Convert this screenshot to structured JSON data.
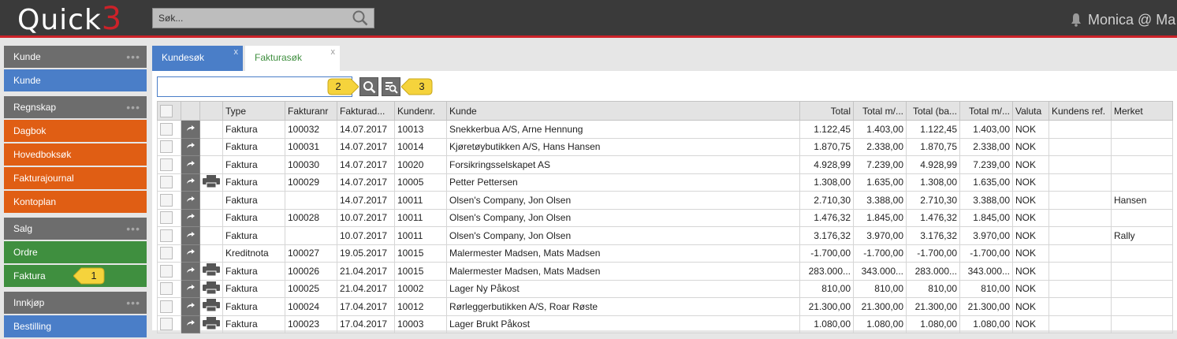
{
  "app": {
    "logo_text": "Quick",
    "logo_num": "3"
  },
  "header": {
    "search_placeholder": "Søk...",
    "user": "Monica @ Ma"
  },
  "sidebar": {
    "kunde_head": "Kunde",
    "kunde_items": [
      "Kunde"
    ],
    "regnskap_head": "Regnskap",
    "regnskap_items": [
      "Dagbok",
      "Hovedboksøk",
      "Fakturajournal",
      "Kontoplan"
    ],
    "salg_head": "Salg",
    "salg_items": [
      "Ordre",
      "Faktura"
    ],
    "innkjop_head": "Innkjøp",
    "innkjop_items": [
      "Bestilling"
    ],
    "dots": "•••"
  },
  "callouts": {
    "c1": "1",
    "c2": "2",
    "c3": "3"
  },
  "tabs": [
    {
      "label": "Kundesøk",
      "close": "x"
    },
    {
      "label": "Fakturasøk",
      "close": "x"
    }
  ],
  "filter": {
    "value": ""
  },
  "table": {
    "columns": [
      "",
      "",
      "",
      "Type",
      "Fakturanr",
      "Fakturad...",
      "Kundenr.",
      "Kunde",
      "Total",
      "Total m/...",
      "Total (ba...",
      "Total m/...",
      "Valuta",
      "Kundens ref.",
      "Merket"
    ],
    "rows": [
      {
        "print": false,
        "type": "Faktura",
        "nr": "100032",
        "date": "14.07.2017",
        "kundenr": "10013",
        "kunde": "Snekkerbua A/S, Arne Hennung",
        "t1": "1.122,45",
        "t2": "1.403,00",
        "t3": "1.122,45",
        "t4": "1.403,00",
        "valuta": "NOK",
        "ref": "",
        "merket": ""
      },
      {
        "print": false,
        "type": "Faktura",
        "nr": "100031",
        "date": "14.07.2017",
        "kundenr": "10014",
        "kunde": "Kjøretøybutikken A/S, Hans Hansen",
        "t1": "1.870,75",
        "t2": "2.338,00",
        "t3": "1.870,75",
        "t4": "2.338,00",
        "valuta": "NOK",
        "ref": "",
        "merket": ""
      },
      {
        "print": false,
        "type": "Faktura",
        "nr": "100030",
        "date": "14.07.2017",
        "kundenr": "10020",
        "kunde": "Forsikringsselskapet AS",
        "t1": "4.928,99",
        "t2": "7.239,00",
        "t3": "4.928,99",
        "t4": "7.239,00",
        "valuta": "NOK",
        "ref": "",
        "merket": ""
      },
      {
        "print": true,
        "type": "Faktura",
        "nr": "100029",
        "date": "14.07.2017",
        "kundenr": "10005",
        "kunde": "Petter Pettersen",
        "t1": "1.308,00",
        "t2": "1.635,00",
        "t3": "1.308,00",
        "t4": "1.635,00",
        "valuta": "NOK",
        "ref": "",
        "merket": ""
      },
      {
        "print": false,
        "type": "Faktura",
        "nr": "",
        "date": "14.07.2017",
        "kundenr": "10011",
        "kunde": "Olsen's Company, Jon Olsen",
        "t1": "2.710,30",
        "t2": "3.388,00",
        "t3": "2.710,30",
        "t4": "3.388,00",
        "valuta": "NOK",
        "ref": "",
        "merket": "Hansen"
      },
      {
        "print": false,
        "type": "Faktura",
        "nr": "100028",
        "date": "10.07.2017",
        "kundenr": "10011",
        "kunde": "Olsen's Company, Jon Olsen",
        "t1": "1.476,32",
        "t2": "1.845,00",
        "t3": "1.476,32",
        "t4": "1.845,00",
        "valuta": "NOK",
        "ref": "",
        "merket": ""
      },
      {
        "print": false,
        "type": "Faktura",
        "nr": "",
        "date": "10.07.2017",
        "kundenr": "10011",
        "kunde": "Olsen's Company, Jon Olsen",
        "t1": "3.176,32",
        "t2": "3.970,00",
        "t3": "3.176,32",
        "t4": "3.970,00",
        "valuta": "NOK",
        "ref": "",
        "merket": "Rally"
      },
      {
        "print": false,
        "type": "Kreditnota",
        "nr": "100027",
        "date": "19.05.2017",
        "kundenr": "10015",
        "kunde": "Malermester Madsen, Mats Madsen",
        "t1": "-1.700,00",
        "t2": "-1.700,00",
        "t3": "-1.700,00",
        "t4": "-1.700,00",
        "valuta": "NOK",
        "ref": "",
        "merket": ""
      },
      {
        "print": true,
        "type": "Faktura",
        "nr": "100026",
        "date": "21.04.2017",
        "kundenr": "10015",
        "kunde": "Malermester Madsen, Mats Madsen",
        "t1": "283.000...",
        "t2": "343.000...",
        "t3": "283.000...",
        "t4": "343.000...",
        "valuta": "NOK",
        "ref": "",
        "merket": ""
      },
      {
        "print": true,
        "type": "Faktura",
        "nr": "100025",
        "date": "21.04.2017",
        "kundenr": "10002",
        "kunde": "Lager Ny Påkost",
        "t1": "810,00",
        "t2": "810,00",
        "t3": "810,00",
        "t4": "810,00",
        "valuta": "NOK",
        "ref": "",
        "merket": ""
      },
      {
        "print": true,
        "type": "Faktura",
        "nr": "100024",
        "date": "17.04.2017",
        "kundenr": "10012",
        "kunde": "Rørleggerbutikken A/S, Roar Røste",
        "t1": "21.300,00",
        "t2": "21.300,00",
        "t3": "21.300,00",
        "t4": "21.300,00",
        "valuta": "NOK",
        "ref": "",
        "merket": ""
      },
      {
        "print": true,
        "type": "Faktura",
        "nr": "100023",
        "date": "17.04.2017",
        "kundenr": "10003",
        "kunde": "Lager Brukt Påkost",
        "t1": "1.080,00",
        "t2": "1.080,00",
        "t3": "1.080,00",
        "t4": "1.080,00",
        "valuta": "NOK",
        "ref": "",
        "merket": ""
      }
    ]
  },
  "colors": {
    "accent_red": "#cc2229",
    "blue": "#4a7ec8",
    "orange": "#e05e14",
    "green": "#3f8f3f",
    "grey": "#6d6d6d",
    "callout_yellow": "#f5d33c"
  },
  "icons": {
    "search": "search-icon",
    "advanced_search": "advanced-search-icon",
    "bell": "bell-icon",
    "row_arrow": "arrow-icon",
    "print": "printer-icon"
  }
}
